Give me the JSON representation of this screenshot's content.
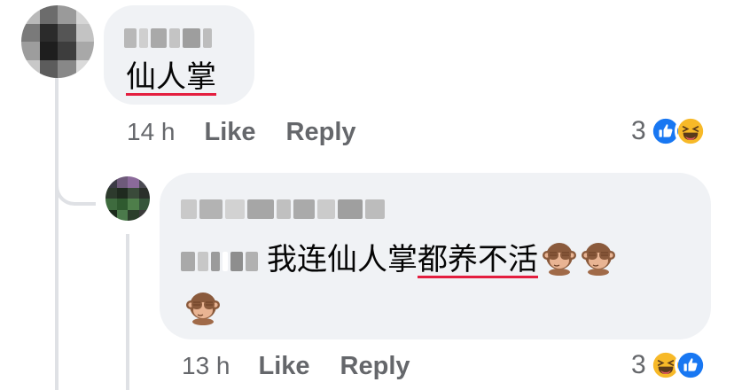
{
  "comments": [
    {
      "author_redacted": true,
      "text_plain": "",
      "text_underlined": "仙人掌",
      "time": "14 h",
      "like_label": "Like",
      "reply_label": "Reply",
      "reaction_count": "3",
      "reaction_icons": [
        "like-icon",
        "haha-icon"
      ]
    },
    {
      "author_redacted": true,
      "mention_redacted": true,
      "text_plain": "我连仙人掌",
      "text_underlined": "都养不活",
      "trailing_emoji": [
        "see-no-evil-monkey-emoji",
        "see-no-evil-monkey-emoji",
        "see-no-evil-monkey-emoji"
      ],
      "time": "13 h",
      "like_label": "Like",
      "reply_label": "Reply",
      "reaction_count": "3",
      "reaction_icons": [
        "haha-icon",
        "like-icon"
      ]
    }
  ],
  "colors": {
    "bubble": "#f0f2f5",
    "meta_text": "#65676b",
    "underline": "#e41e3f",
    "like_blue": "#1877f2",
    "haha_yellow": "#f7b928"
  }
}
